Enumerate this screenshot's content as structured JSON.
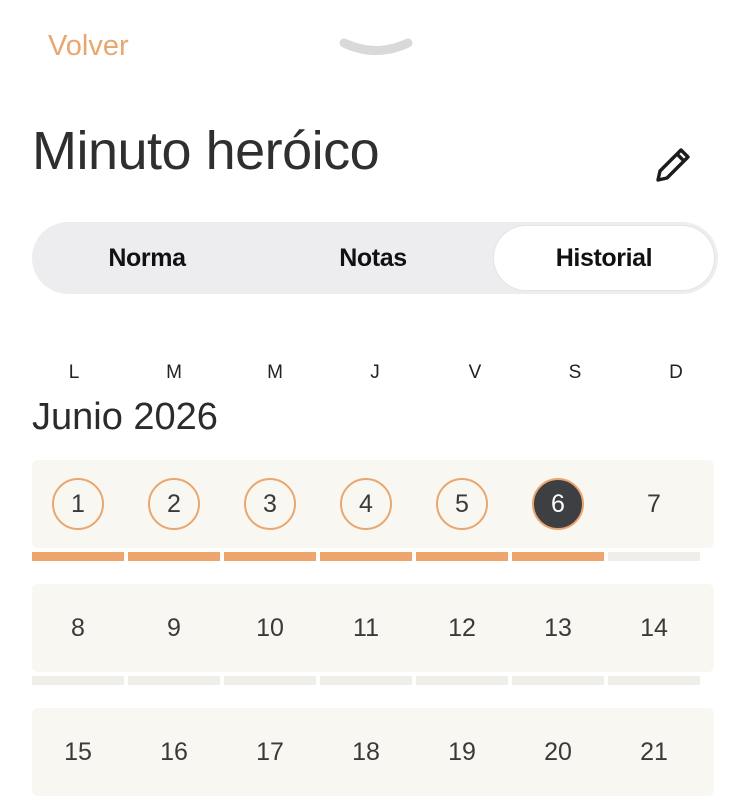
{
  "header": {
    "back_label": "Volver",
    "title": "Minuto heróico"
  },
  "tabs": [
    {
      "label": "Norma",
      "active": false
    },
    {
      "label": "Notas",
      "active": false
    },
    {
      "label": "Historial",
      "active": true
    }
  ],
  "calendar": {
    "weekdays": [
      "L",
      "M",
      "M",
      "J",
      "V",
      "S",
      "D"
    ],
    "month_label": "Junio 2026",
    "weeks": [
      {
        "days": [
          "1",
          "2",
          "3",
          "4",
          "5",
          "6",
          "7"
        ],
        "completed": [
          true,
          true,
          true,
          true,
          true,
          true,
          false
        ],
        "selected_index": 5
      },
      {
        "days": [
          "8",
          "9",
          "10",
          "11",
          "12",
          "13",
          "14"
        ],
        "completed": [
          false,
          false,
          false,
          false,
          false,
          false,
          false
        ],
        "selected_index": -1
      },
      {
        "days": [
          "15",
          "16",
          "17",
          "18",
          "19",
          "20",
          "21"
        ],
        "completed": [
          false,
          false,
          false,
          false,
          false,
          false,
          false
        ],
        "selected_index": -1
      }
    ]
  },
  "colors": {
    "accent": "#e9a66f",
    "selected_day_fill": "#3d3f42"
  },
  "icons": {
    "grabber": "chevron-down-icon",
    "edit": "pencil-icon"
  }
}
